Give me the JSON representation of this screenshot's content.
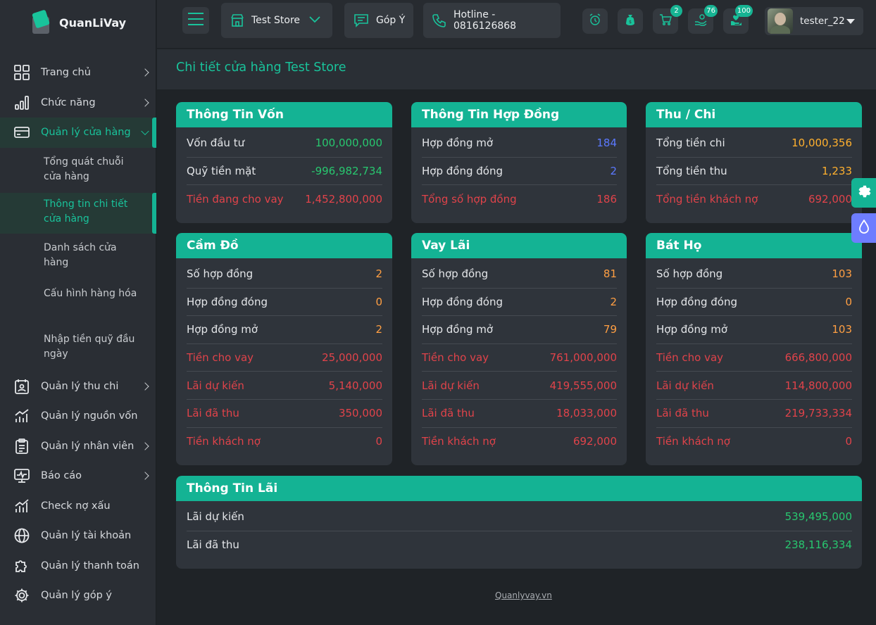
{
  "brand": {
    "name": "QuanLiVay"
  },
  "sidebar": {
    "items": [
      {
        "label": "Trang chủ"
      },
      {
        "label": "Chức năng"
      },
      {
        "label": "Quản lý cửa hàng"
      },
      {
        "label": "Quản lý thu chi"
      },
      {
        "label": "Quản lý nguồn vốn"
      },
      {
        "label": "Quản lý nhân viên"
      },
      {
        "label": "Báo cáo"
      },
      {
        "label": "Check nợ xấu"
      },
      {
        "label": "Quản lý tài khoản"
      },
      {
        "label": "Quản lý thanh toán"
      },
      {
        "label": "Quản lý góp ý"
      }
    ],
    "sub_items": [
      {
        "label": "Tổng quát chuỗi cửa hàng"
      },
      {
        "label": "Thông tin chi tiết cửa hàng"
      },
      {
        "label": "Danh sách cửa hàng"
      },
      {
        "label": "Cấu hình hàng hóa"
      },
      {
        "label": "Nhập tiền quỹ đầu ngày"
      }
    ]
  },
  "header": {
    "store_select": "Test Store",
    "feedback": "Góp Ý",
    "hotline": "Hotline - 0816126868",
    "badges": {
      "cart": "2",
      "hand": "76",
      "heart": "100"
    },
    "user": "tester_22"
  },
  "page": {
    "title": "Chi tiết cửa hàng Test Store"
  },
  "cards": {
    "von": {
      "title": "Thông Tin Vốn",
      "rows": [
        {
          "label": "Vốn đầu tư",
          "value": "100,000,000"
        },
        {
          "label": "Quỹ tiền mặt",
          "value": "-996,982,734"
        },
        {
          "label": "Tiền đang cho vay",
          "value": "1,452,800,000"
        }
      ]
    },
    "hopdong": {
      "title": "Thông Tin Hợp Đồng",
      "rows": [
        {
          "label": "Hợp đồng mở",
          "value": "184"
        },
        {
          "label": "Hợp đồng đóng",
          "value": "2"
        },
        {
          "label": "Tổng số hợp đồng",
          "value": "186"
        }
      ]
    },
    "thuchi": {
      "title": "Thu / Chi",
      "rows": [
        {
          "label": "Tổng tiền chi",
          "value": "10,000,356"
        },
        {
          "label": "Tổng tiền thu",
          "value": "1,233"
        },
        {
          "label": "Tổng tiền khách nợ",
          "value": "692,000"
        }
      ]
    },
    "camdo": {
      "title": "Cầm Đồ",
      "rows": [
        {
          "label": "Số hợp đồng",
          "value": "2"
        },
        {
          "label": "Hợp đồng đóng",
          "value": "0"
        },
        {
          "label": "Hợp đồng mở",
          "value": "2"
        },
        {
          "label": "Tiền cho vay",
          "value": "25,000,000"
        },
        {
          "label": "Lãi dự kiến",
          "value": "5,140,000"
        },
        {
          "label": "Lãi đã thu",
          "value": "350,000"
        },
        {
          "label": "Tiền khách nợ",
          "value": "0"
        }
      ]
    },
    "vaylai": {
      "title": "Vay Lãi",
      "rows": [
        {
          "label": "Số hợp đồng",
          "value": "81"
        },
        {
          "label": "Hợp đồng đóng",
          "value": "2"
        },
        {
          "label": "Hợp đồng mở",
          "value": "79"
        },
        {
          "label": "Tiền cho vay",
          "value": "761,000,000"
        },
        {
          "label": "Lãi dự kiến",
          "value": "419,555,000"
        },
        {
          "label": "Lãi đã thu",
          "value": "18,033,000"
        },
        {
          "label": "Tiền khách nợ",
          "value": "692,000"
        }
      ]
    },
    "batho": {
      "title": "Bát Họ",
      "rows": [
        {
          "label": "Số hợp đồng",
          "value": "103"
        },
        {
          "label": "Hợp đồng đóng",
          "value": "0"
        },
        {
          "label": "Hợp đồng mở",
          "value": "103"
        },
        {
          "label": "Tiền cho vay",
          "value": "666,800,000"
        },
        {
          "label": "Lãi dự kiến",
          "value": "114,800,000"
        },
        {
          "label": "Lãi đã thu",
          "value": "219,733,334"
        },
        {
          "label": "Tiền khách nợ",
          "value": "0"
        }
      ]
    },
    "lai": {
      "title": "Thông Tin Lãi",
      "rows": [
        {
          "label": "Lãi dự kiến",
          "value": "539,495,000"
        },
        {
          "label": "Lãi đã thu",
          "value": "238,116,334"
        }
      ]
    }
  },
  "footer": {
    "link": "Quanlyvay.vn"
  },
  "colors": {
    "accent": "#14b394",
    "positive": "#28c76f",
    "negative": "#e0434a",
    "count": "#ff9f43",
    "info": "#5b79ff"
  }
}
